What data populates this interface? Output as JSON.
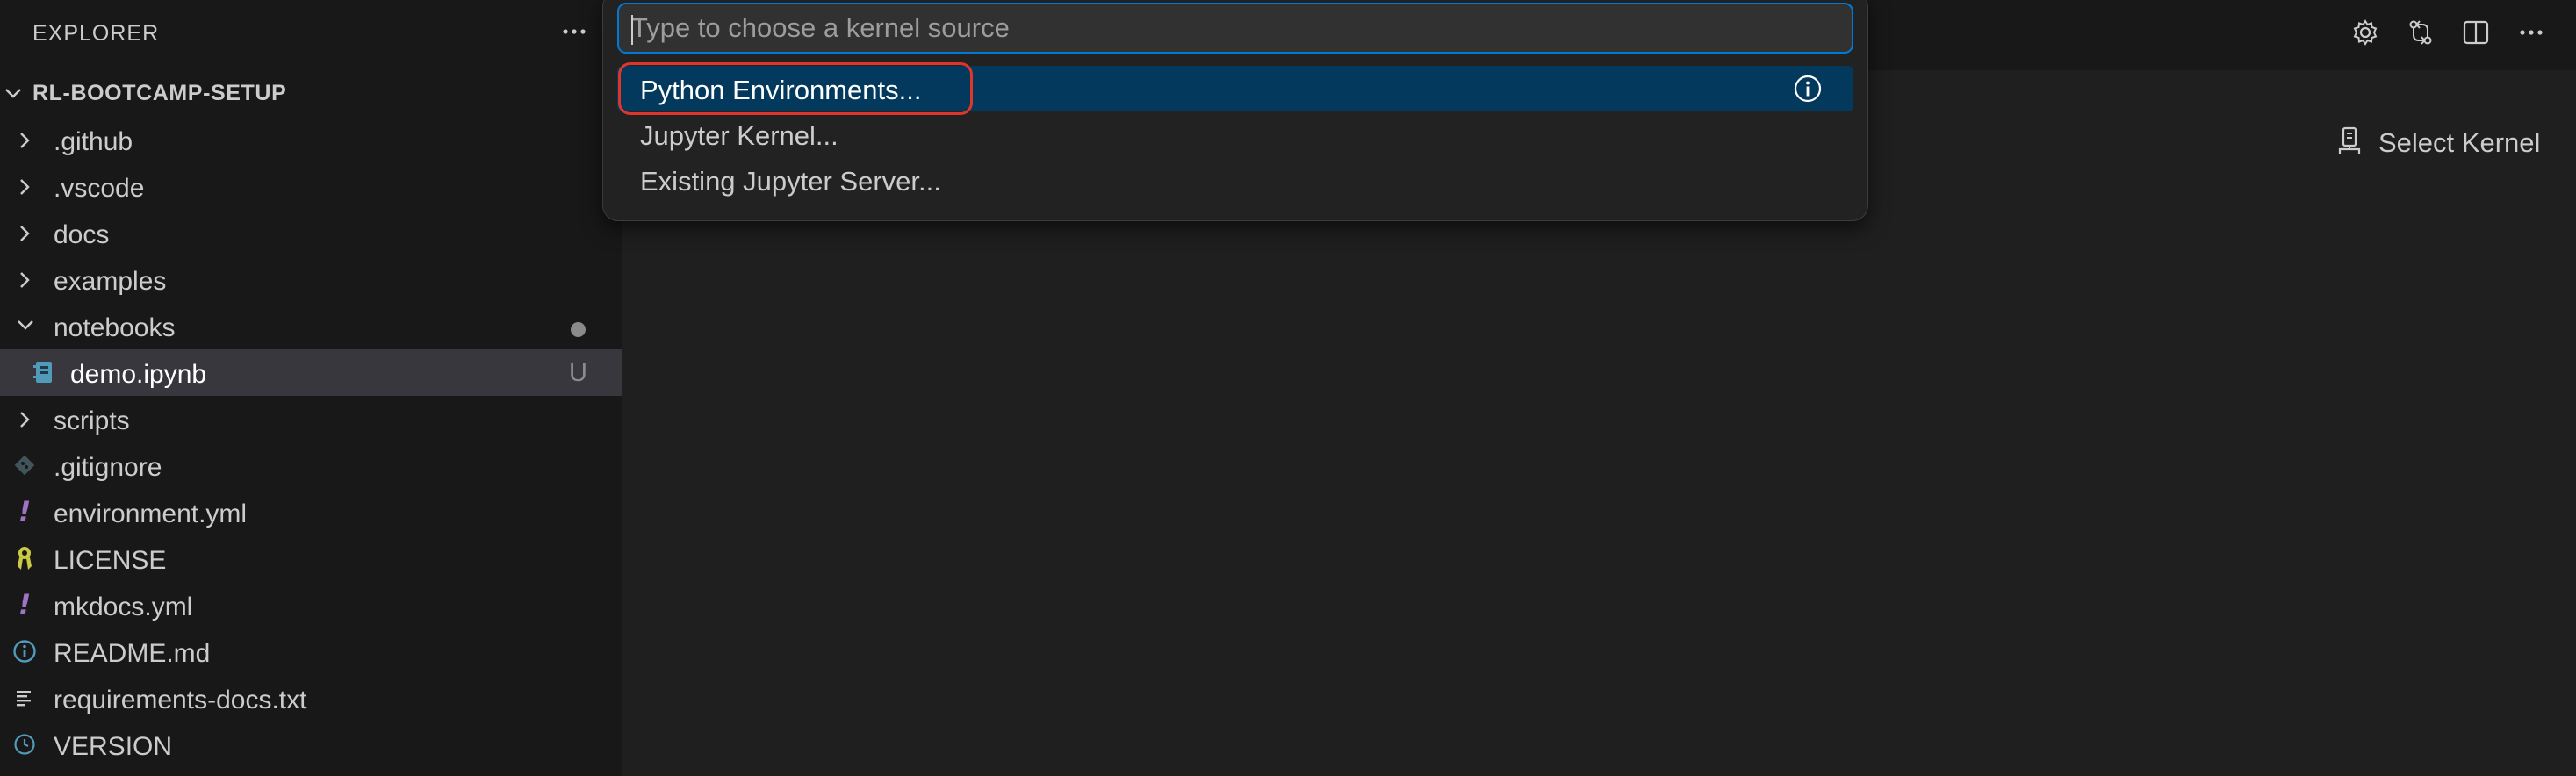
{
  "sidebar": {
    "title": "EXPLORER",
    "root_label": "RL-BOOTCAMP-SETUP",
    "items": [
      {
        "label": ".github",
        "type": "folder",
        "expanded": false
      },
      {
        "label": ".vscode",
        "type": "folder",
        "expanded": false
      },
      {
        "label": "docs",
        "type": "folder",
        "expanded": false
      },
      {
        "label": "examples",
        "type": "folder",
        "expanded": false
      },
      {
        "label": "notebooks",
        "type": "folder",
        "expanded": true,
        "badge": "modified-dot"
      },
      {
        "label": "demo.ipynb",
        "type": "notebook-file",
        "selected": true,
        "badge": "U"
      },
      {
        "label": "scripts",
        "type": "folder",
        "expanded": false
      },
      {
        "label": ".gitignore",
        "type": "file",
        "icon": "git-icon"
      },
      {
        "label": "environment.yml",
        "type": "file",
        "icon": "yaml-icon"
      },
      {
        "label": "LICENSE",
        "type": "file",
        "icon": "license-icon"
      },
      {
        "label": "mkdocs.yml",
        "type": "file",
        "icon": "yaml-icon"
      },
      {
        "label": "README.md",
        "type": "file",
        "icon": "info-icon"
      },
      {
        "label": "requirements-docs.txt",
        "type": "file",
        "icon": "text-lines-icon"
      },
      {
        "label": "VERSION",
        "type": "file",
        "icon": "clock-icon"
      }
    ],
    "badges": {
      "notebooks": "●",
      "demo": "U"
    }
  },
  "quickpick": {
    "placeholder": "Type to choose a kernel source",
    "value": "",
    "items": [
      {
        "label": "Python Environments...",
        "active": true
      },
      {
        "label": "Jupyter Kernel..."
      },
      {
        "label": "Existing Jupyter Server..."
      }
    ]
  },
  "editor": {
    "select_kernel_label": "Select Kernel",
    "top_actions": [
      "gear-icon",
      "compare-changes-icon",
      "split-editor-icon",
      "more-actions-icon"
    ]
  },
  "colors": {
    "accent": "#0078d4",
    "active_item_bg": "#04395e",
    "highlight_ring": "#e0352b",
    "yaml_icon": "#a074c4",
    "info_icon": "#519aba",
    "notebook_icon": "#519aba",
    "license_icon": "#cbcb41"
  }
}
